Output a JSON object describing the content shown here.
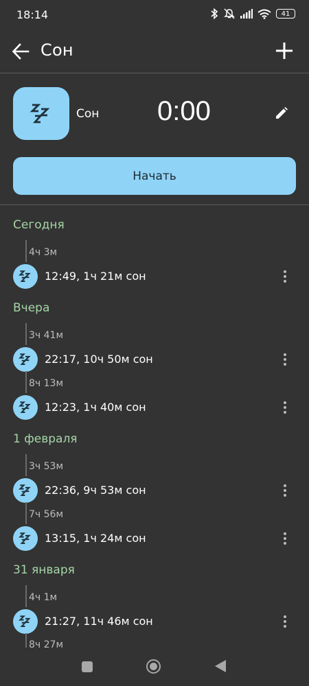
{
  "status_bar": {
    "time": "18:14",
    "battery": "41",
    "icons": [
      "bluetooth-icon",
      "mute-icon",
      "signal-icon",
      "wifi-icon",
      "battery-icon"
    ]
  },
  "app_bar": {
    "title": "Сон"
  },
  "activity": {
    "name": "Сон",
    "timer": "0:00",
    "start_label": "Начать",
    "accent_color": "#8fd4f7"
  },
  "history": [
    {
      "day": "Сегодня",
      "entries": [
        {
          "gap": "4ч 3м",
          "text": "12:49, 1ч 21м сон"
        }
      ]
    },
    {
      "day": "Вчера",
      "entries": [
        {
          "gap": "3ч 41м",
          "text": "22:17, 10ч 50м сон"
        },
        {
          "gap": "8ч 13м",
          "text": "12:23, 1ч 40м сон"
        }
      ]
    },
    {
      "day": "1 февраля",
      "entries": [
        {
          "gap": "3ч 53м",
          "text": "22:36, 9ч 53м сон"
        },
        {
          "gap": "7ч 56м",
          "text": "13:15, 1ч 24м сон"
        }
      ]
    },
    {
      "day": "31 января",
      "entries": [
        {
          "gap": "4ч 1м",
          "text": "21:27, 11ч 46м сон"
        },
        {
          "gap": "8ч 27м",
          "text": ""
        }
      ]
    }
  ],
  "colors": {
    "background": "#333333",
    "day_header": "#a5d6a7",
    "accent": "#8fd4f7"
  }
}
